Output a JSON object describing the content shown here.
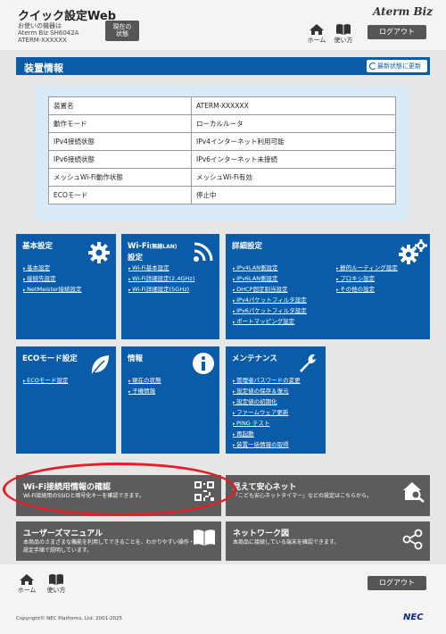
{
  "header": {
    "app_title": "クイック設定Web",
    "device_label": "お使いの機器は",
    "model": "Aterm Biz SH6042A",
    "device_name": "ATERM-XXXXXX",
    "status_button": "現在の\n状態",
    "brand": "Aterm Biz",
    "home_label": "ホーム",
    "help_label": "使い方",
    "logout_label": "ログアウト"
  },
  "device_info": {
    "title": "装置情報",
    "refresh_label": "最新状態に更新",
    "rows": [
      {
        "label": "装置名",
        "value": "ATERM-XXXXXX"
      },
      {
        "label": "動作モード",
        "value": "ローカルルータ"
      },
      {
        "label": "IPv4接続状態",
        "value": "IPv4インターネット利用可能"
      },
      {
        "label": "IPv6接続状態",
        "value": "IPv6インターネット未接続"
      },
      {
        "label": "メッシュWi-Fi動作状態",
        "value": "メッシュWi-Fi有効"
      },
      {
        "label": "ECOモード",
        "value": "停止中"
      }
    ]
  },
  "tiles": {
    "basic": {
      "title": "基本設定",
      "links": [
        "基本設定",
        "接続先設定",
        "NetMeister接続設定"
      ]
    },
    "wifi": {
      "title": "Wi-Fi",
      "title_small": "(無線LAN)",
      "title_line2": "設定",
      "links": [
        "Wi-Fi基本設定",
        "Wi-Fi詳細設定(2.4GHz)",
        "Wi-Fi詳細設定(5GHz)"
      ]
    },
    "advanced": {
      "title": "詳細設定",
      "links_col1": [
        "IPv4LAN側設定",
        "IPv6LAN側設定",
        "DHCP固定割当設定",
        "IPv4パケットフィルタ設定",
        "IPv6パケットフィルタ設定",
        "ポートマッピング設定"
      ],
      "links_col2": [
        "静的ルーティング設定",
        "プロキシ設定",
        "その他の設定"
      ]
    },
    "eco": {
      "title": "ECOモード設定",
      "links": [
        "ECOモード設定"
      ]
    },
    "info": {
      "title": "情報",
      "links": [
        "現在の状態",
        "子機情報"
      ]
    },
    "maintenance": {
      "title": "メンテナンス",
      "links": [
        "管理者パスワードの変更",
        "設定値の保存＆復元",
        "設定値の初期化",
        "ファームウェア更新",
        "PING テスト",
        "再起動",
        "装置一括情報の取得"
      ]
    }
  },
  "gray_tiles": {
    "wifi_check": {
      "title": "Wi-Fi接続用情報の確認",
      "desc": "Wi-Fi接続用のSSIDと暗号化キーを確認できます。"
    },
    "safety": {
      "title": "見えて安心ネット",
      "desc": "「こども安心ネットタイマー」などの設定はこちらから。"
    },
    "manual": {
      "title": "ユーザーズマニュアル",
      "desc": "本商品のさまざまな機能を利用してできることを、わかりやすい操作・設定手順で説明しています。"
    },
    "network_map": {
      "title": "ネットワーク図",
      "desc": "本商品に接続している端末を確認できます。"
    }
  },
  "footer": {
    "home_label": "ホーム",
    "help_label": "使い方",
    "logout_label": "ログアウト",
    "copyright": "Copyright© NEC Platforms, Ltd. 2001-2025",
    "nec_logo": "NEC"
  },
  "colors": {
    "tile_blue": "#0a5ca8",
    "tile_gray": "#5c5c5c",
    "highlight": "#e21e26"
  }
}
